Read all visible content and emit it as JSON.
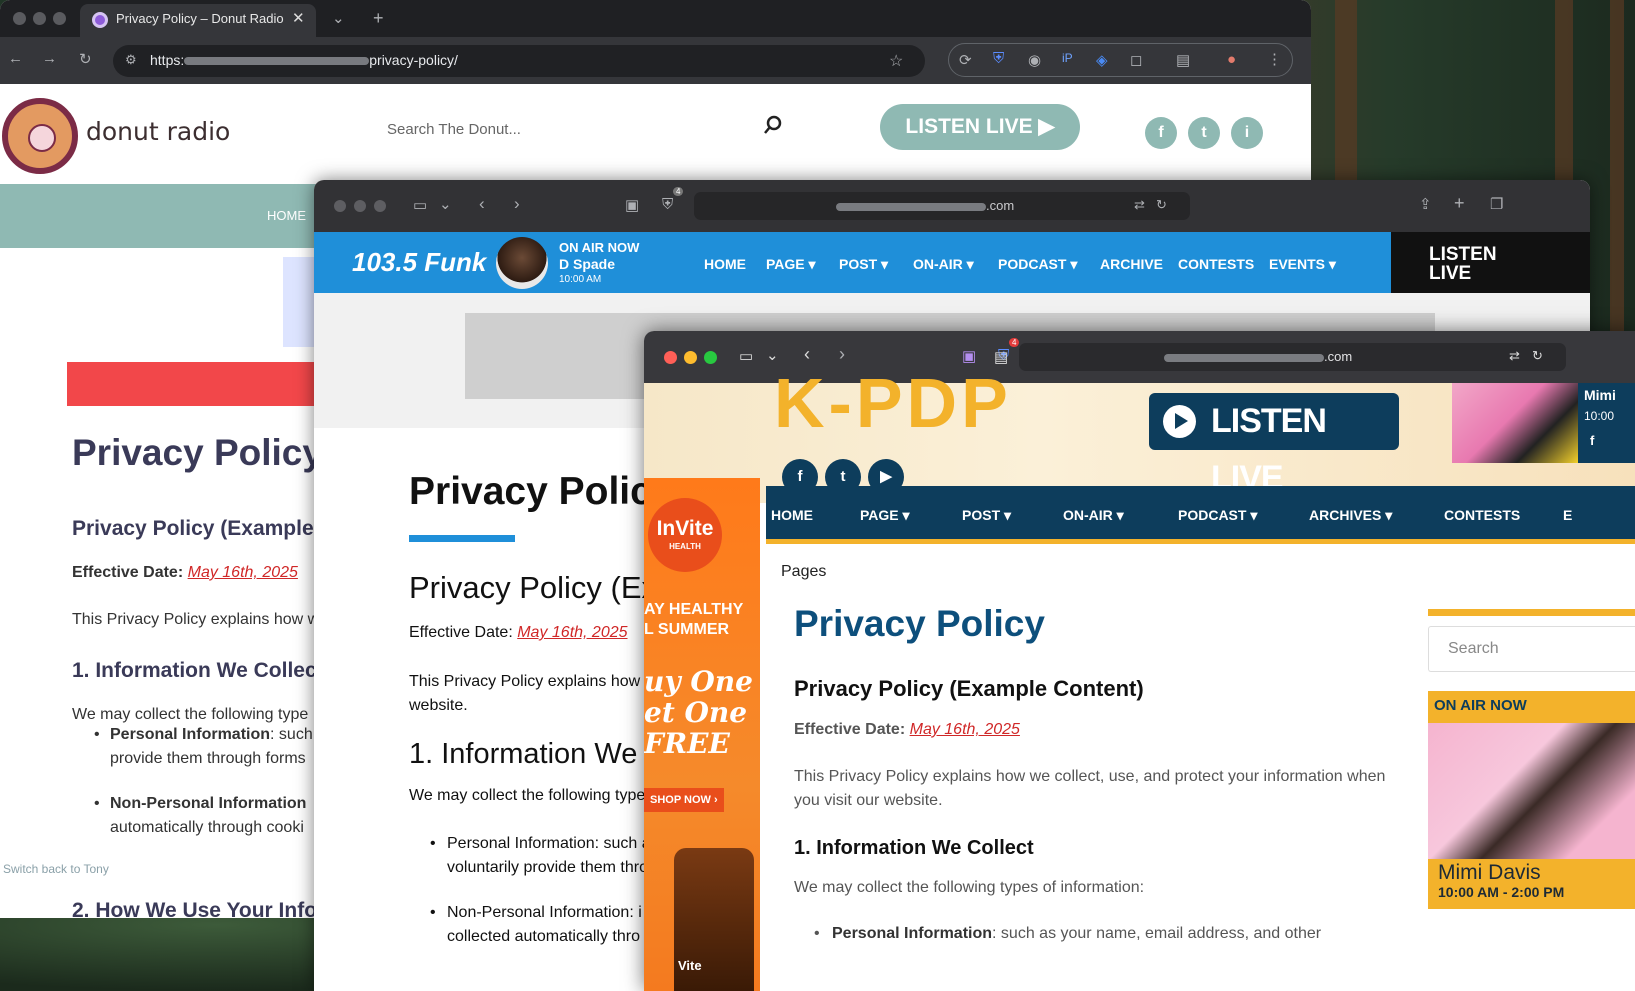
{
  "window1": {
    "tab_title": "Privacy Policy – Donut Radio",
    "url_prefix": "https:",
    "url_suffix": "privacy-policy/",
    "site": {
      "logo_text": "donut radio",
      "search_placeholder": "Search The Donut...",
      "listen_live": "LISTEN LIVE",
      "social": [
        "f",
        "t",
        "i"
      ],
      "nav_home": "HOME",
      "h1": "Privacy Policy",
      "h2": "Privacy Policy (Example",
      "effective_label": "Effective Date:",
      "effective_date": "May 16th, 2025",
      "intro": "This Privacy Policy explains how w",
      "section1": "1. Information We Collect",
      "collect_intro": "We may collect the following type",
      "li1_bold": "Personal Information",
      "li1_rest": ": such",
      "li1_line2": "provide them through forms",
      "li2_bold": "Non-Personal Information",
      "li2_line2": "automatically through cooki",
      "switch_back": "Switch back to Tony",
      "section2": "2. How We Use Your Infor"
    }
  },
  "window2": {
    "url_suffix": ".com",
    "badge": "4",
    "site": {
      "logo": "103.5 Funk",
      "on_air_label": "ON AIR NOW",
      "dj_name": "D Spade",
      "dj_time": "10:00 AM",
      "menu": [
        "HOME",
        "PAGE ▾",
        "POST ▾",
        "ON-AIR ▾",
        "PODCAST ▾",
        "ARCHIVE",
        "CONTESTS",
        "EVENTS ▾"
      ],
      "listen_line1": "LISTEN",
      "listen_line2": "LIVE",
      "h1": "Privacy Policy",
      "h2": "Privacy Policy (Ex",
      "effective_label": "Effective Date:",
      "effective_date": "May 16th, 2025",
      "intro_line1": "This Privacy Policy explains how w",
      "intro_line2": "website.",
      "section1": "1. Information We C",
      "collect_intro": "We may collect the following type",
      "li1_line1": "Personal Information: such a",
      "li1_line2": "voluntarily provide them thro",
      "li2_line1": "Non-Personal Information: i",
      "li2_line2": "collected automatically thro"
    }
  },
  "window3": {
    "url_suffix": ".com",
    "badge": "4",
    "site": {
      "logo": "K-PDP",
      "social": [
        "f",
        "t",
        "▶"
      ],
      "listen_live": "LISTEN LIVE",
      "top_host_name": "Mimi",
      "top_host_time": "10:00",
      "top_host_icon": "f",
      "ad": {
        "brand": "InVite",
        "brand_sub": "HEALTH",
        "line1": "AY HEALTHY",
        "line2": "L SUMMER",
        "offer1": "uy One",
        "offer2": "et One",
        "offer3": "FREE",
        "shop": "SHOP NOW ›",
        "bottle_label": "Vite"
      },
      "menu": [
        "HOME",
        "PAGE ▾",
        "POST ▾",
        "ON-AIR ▾",
        "PODCAST ▾",
        "ARCHIVES ▾",
        "CONTESTS",
        "E"
      ],
      "breadcrumb": "Pages",
      "h1": "Privacy Policy",
      "h2": "Privacy Policy (Example Content)",
      "effective_label": "Effective Date:",
      "effective_date": "May 16th, 2025",
      "intro": "This Privacy Policy explains how we collect, use, and protect your information when you visit our website.",
      "section1": "1. Information We Collect",
      "collect_intro": "We may collect the following types of information:",
      "li1_bold": "Personal Information",
      "li1_rest": ": such as your name, email address, and other",
      "search_placeholder": "Search",
      "on_air_label": "ON AIR NOW",
      "host_name": "Mimi Davis",
      "host_time": "10:00 AM - 2:00 PM"
    }
  }
}
